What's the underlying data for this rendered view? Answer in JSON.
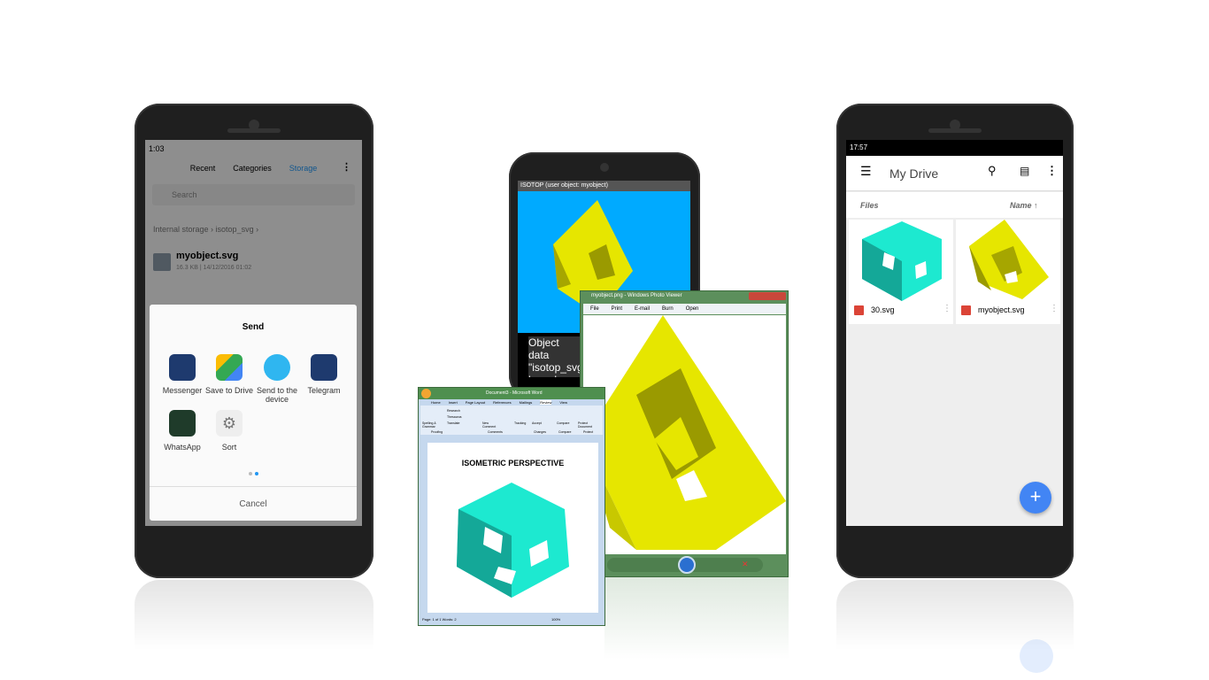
{
  "left_phone": {
    "status_time": "1:03",
    "tabs": [
      "Recent",
      "Categories",
      "Storage"
    ],
    "active_tab": "Storage",
    "search_placeholder": "Search",
    "breadcrumb": [
      "Internal storage",
      "isotop_svg"
    ],
    "file": {
      "name": "myobject.svg",
      "meta": "16.3 KB | 14/12/2016 01:02"
    },
    "dialog": {
      "title": "Send",
      "apps": [
        "Messenger",
        "Save to Drive",
        "Send to the device",
        "Telegram",
        "WhatsApp",
        "Sort"
      ],
      "cancel": "Cancel"
    }
  },
  "middle_phone": {
    "title": "ISOTOP (user object: myobject)",
    "message": "Object data \"isotop_svg have been"
  },
  "photo_viewer": {
    "title": "myobject.png - Windows Photo Viewer",
    "menu": [
      "File",
      "Print",
      "E-mail",
      "Burn",
      "Open"
    ]
  },
  "word": {
    "title": "Document3 - Microsoft Word",
    "tabs": [
      "Home",
      "Insert",
      "Page Layout",
      "References",
      "Mailings",
      "Review",
      "View"
    ],
    "active_tab": "Review",
    "ribbon": [
      "Spelling & Grammar",
      "Research",
      "Thesaurus",
      "Translate",
      "New Comment",
      "Tracking",
      "Accept",
      "Compare",
      "Protect Document"
    ],
    "groups": [
      "Proofing",
      "Comments",
      "Changes",
      "Compare",
      "Protect"
    ],
    "heading": "ISOMETRIC PERSPECTIVE",
    "status": "Page: 1 of 1   Words: 2",
    "zoom": "100%"
  },
  "right_phone": {
    "status_time": "17:57",
    "title": "My Drive",
    "files_label": "Files",
    "sort_label": "Name",
    "files": [
      "30.svg",
      "myobject.svg"
    ]
  },
  "colors": {
    "yellow": "#e6e600",
    "cyan": "#1de9d0",
    "drive_blue": "#4285f4",
    "sky": "#00aaff"
  }
}
